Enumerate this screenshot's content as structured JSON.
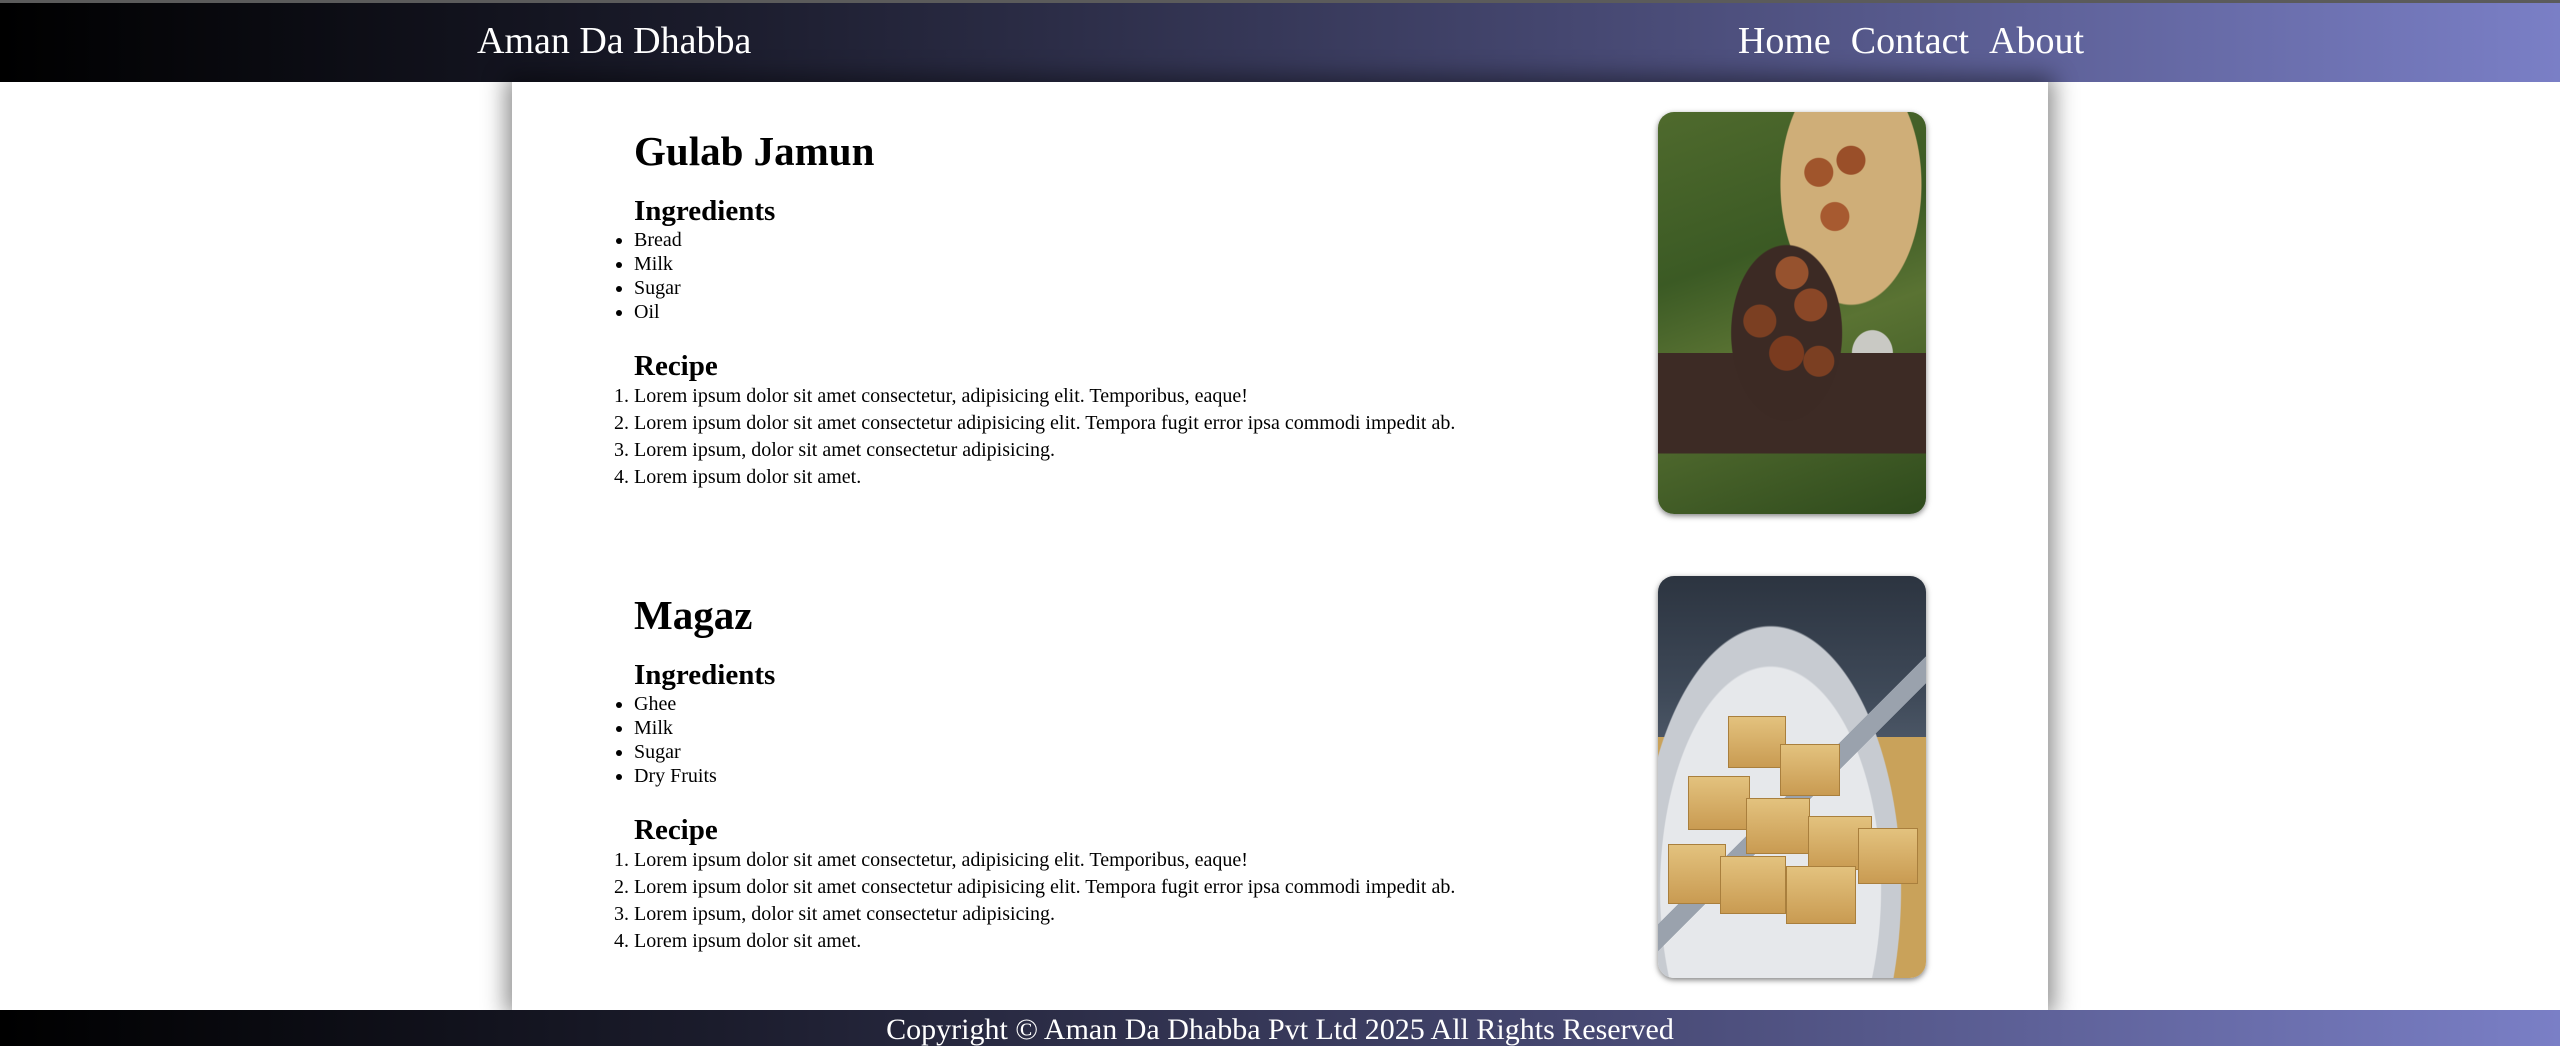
{
  "navbar": {
    "brand": "Aman Da Dhabba",
    "links": [
      "Home",
      "Contact",
      "About"
    ]
  },
  "dishes": [
    {
      "title": "Gulab Jamun",
      "ingredients_heading": "Ingredients",
      "ingredients": [
        "Bread",
        "Milk",
        "Sugar",
        "Oil"
      ],
      "recipe_heading": "Recipe",
      "recipe": [
        "Lorem ipsum dolor sit amet consectetur, adipisicing elit. Temporibus, eaque!",
        "Lorem ipsum dolor sit amet consectetur adipisicing elit. Tempora fugit error ipsa commodi impedit ab.",
        "Lorem ipsum, dolor sit amet consectetur adipisicing.",
        "Lorem ipsum dolor sit amet."
      ],
      "image": "gulab-jamun-photo"
    },
    {
      "title": "Magaz",
      "ingredients_heading": "Ingredients",
      "ingredients": [
        "Ghee",
        "Milk",
        "Sugar",
        "Dry Fruits"
      ],
      "recipe_heading": "Recipe",
      "recipe": [
        "Lorem ipsum dolor sit amet consectetur, adipisicing elit. Temporibus, eaque!",
        "Lorem ipsum dolor sit amet consectetur adipisicing elit. Tempora fugit error ipsa commodi impedit ab.",
        "Lorem ipsum, dolor sit amet consectetur adipisicing.",
        "Lorem ipsum dolor sit amet."
      ],
      "image": "magaz-photo"
    }
  ],
  "footer": {
    "text": "Copyright © Aman Da Dhabba Pvt Ltd 2025 All Rights Reserved"
  },
  "colors": {
    "nav_gradient_start": "#000000",
    "nav_gradient_end": "#7a7fc6",
    "text": "#000000",
    "background": "#ffffff"
  }
}
